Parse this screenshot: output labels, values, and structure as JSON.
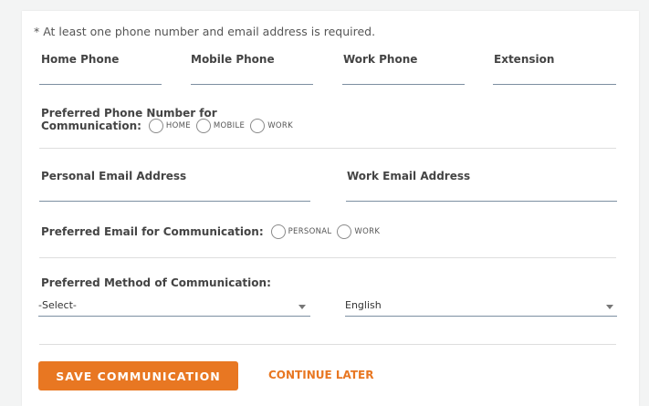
{
  "note": "* At least one phone number and email address is required.",
  "phones": {
    "home_label": "Home Phone",
    "mobile_label": "Mobile Phone",
    "work_label": "Work Phone",
    "extension_label": "Extension",
    "home_value": "",
    "mobile_value": "",
    "work_value": "",
    "extension_value": ""
  },
  "preferred_phone": {
    "label_line1": "Preferred Phone Number for",
    "label_line2": "Communication:",
    "options": [
      "HOME",
      "MOBILE",
      "WORK"
    ]
  },
  "emails": {
    "personal_label": "Personal Email Address",
    "work_label": "Work Email Address",
    "personal_value": "",
    "work_value": ""
  },
  "preferred_email": {
    "label": "Preferred Email for Communication:",
    "options": [
      "PERSONAL",
      "WORK"
    ]
  },
  "preferred_method": {
    "label": "Preferred Method of Communication:",
    "method_selected": "-Select-",
    "language_selected": "English"
  },
  "buttons": {
    "save": "SAVE COMMUNICATION",
    "continue_later": "CONTINUE LATER"
  },
  "colors": {
    "accent": "#e87722",
    "field_line": "#7c8fa1",
    "background": "#f3f4f4"
  }
}
